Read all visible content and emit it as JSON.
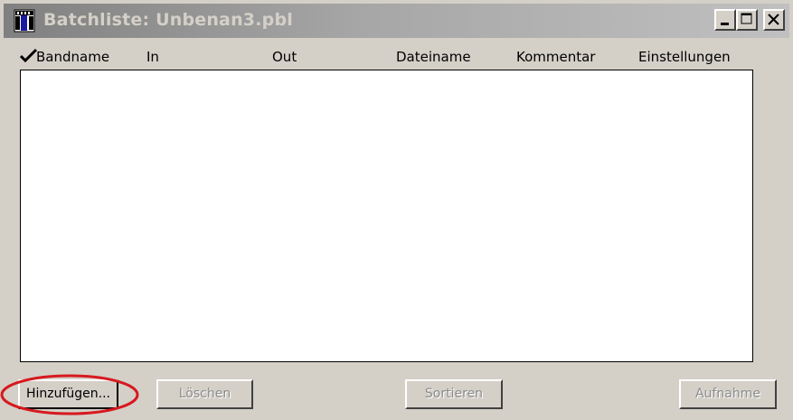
{
  "window": {
    "title": "Batchliste: Unbenan3.pbl",
    "icon": "film-clip-icon"
  },
  "title_buttons": {
    "minimize": "minimize-icon",
    "maximize": "maximize-icon",
    "close": "close-icon"
  },
  "columns": [
    {
      "label": "Bandname",
      "icon": "checkmark-icon"
    },
    {
      "label": "In"
    },
    {
      "label": "Out"
    },
    {
      "label": "Dateiname"
    },
    {
      "label": "Kommentar"
    },
    {
      "label": "Einstellungen"
    }
  ],
  "list": {
    "rows": []
  },
  "buttons": {
    "add": "Hinzufügen...",
    "delete": "Löschen",
    "sort": "Sortieren",
    "record": "Aufnahme"
  },
  "annotation": {
    "color": "#d7191f"
  }
}
